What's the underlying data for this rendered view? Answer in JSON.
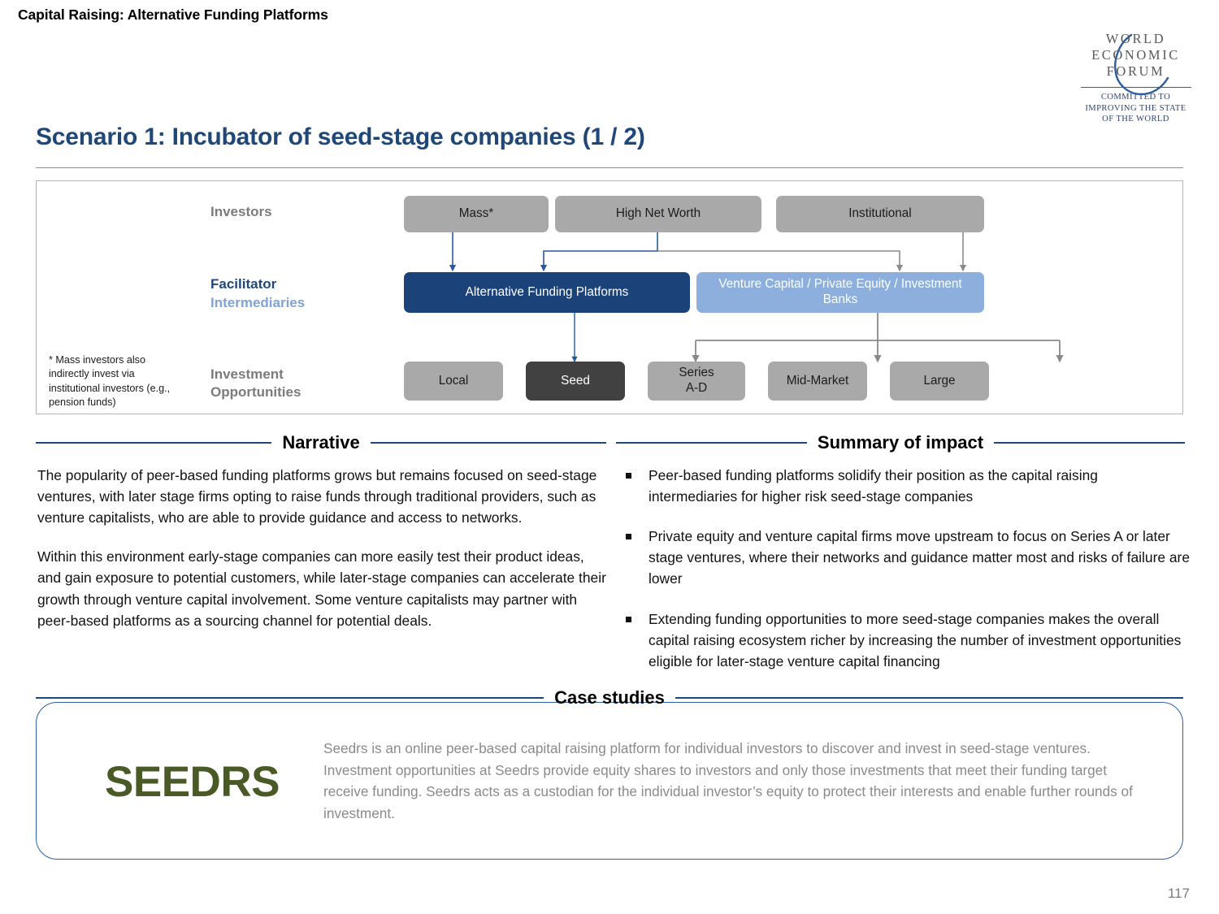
{
  "header": {
    "kicker": "Capital Raising: Alternative Funding Platforms"
  },
  "logo": {
    "line1": "WORLD",
    "line2": "ECONOMIC",
    "line3": "FORUM",
    "tagline1": "COMMITTED TO",
    "tagline2": "IMPROVING THE STATE",
    "tagline3": "OF THE WORLD",
    "brand_color": "#2d4470"
  },
  "title": "Scenario 1: Incubator of seed-stage companies (1 / 2)",
  "diagram": {
    "row_labels": {
      "investors": "Investors",
      "facilitator": "Facilitator",
      "intermediaries": "Intermediaries",
      "investment": "Investment",
      "opportunities": "Opportunities"
    },
    "footnote": "* Mass investors also indirectly invest via institutional investors (e.g., pension funds)",
    "investors": [
      {
        "label": "Mass*"
      },
      {
        "label": "High Net Worth"
      },
      {
        "label": "Institutional"
      }
    ],
    "facilitators": [
      {
        "label": "Alternative Funding Platforms",
        "color": "#1c4379"
      },
      {
        "label": "Venture Capital / Private Equity / Investment Banks",
        "color": "#8cafdd"
      }
    ],
    "opportunities": [
      {
        "label": "Local",
        "color": "#a9a9a9"
      },
      {
        "label": "Seed",
        "color": "#414141"
      },
      {
        "label": "Series\nA-D",
        "color": "#a9a9a9"
      },
      {
        "label": "Mid-Market",
        "color": "#a9a9a9"
      },
      {
        "label": "Large",
        "color": "#a9a9a9"
      }
    ]
  },
  "narrative": {
    "heading": "Narrative",
    "paragraphs": [
      "The popularity of peer-based funding platforms grows but remains focused on seed-stage ventures, with later stage firms opting to raise funds through traditional providers, such as venture capitalists, who are able to provide guidance and access to networks.",
      "Within this environment early-stage companies can more easily test their product ideas, and gain exposure to potential customers, while later-stage companies can accelerate their growth through venture capital involvement. Some venture capitalists may partner with peer-based platforms as a sourcing channel for potential deals."
    ]
  },
  "impact": {
    "heading": "Summary of impact",
    "bullets": [
      "Peer-based funding platforms solidify their position as the capital raising intermediaries for higher risk seed-stage companies",
      "Private equity and venture capital firms move upstream to focus on Series A or later stage ventures, where their networks and guidance matter most and risks of failure are lower",
      "Extending funding opportunities to more seed-stage companies makes the overall capital raising ecosystem richer by increasing the number of investment opportunities eligible for later-stage venture capital financing"
    ]
  },
  "case_studies": {
    "heading": "Case studies",
    "logo_name": "SEEDRS",
    "body": "Seedrs is an online peer-based capital raising platform for individual investors to discover and invest in seed-stage ventures. Investment opportunities at Seedrs provide equity shares to investors and only those investments that meet their funding target receive funding. Seedrs acts as a custodian for the individual investor’s equity to protect their interests and enable further rounds of investment."
  },
  "page_number": "117"
}
